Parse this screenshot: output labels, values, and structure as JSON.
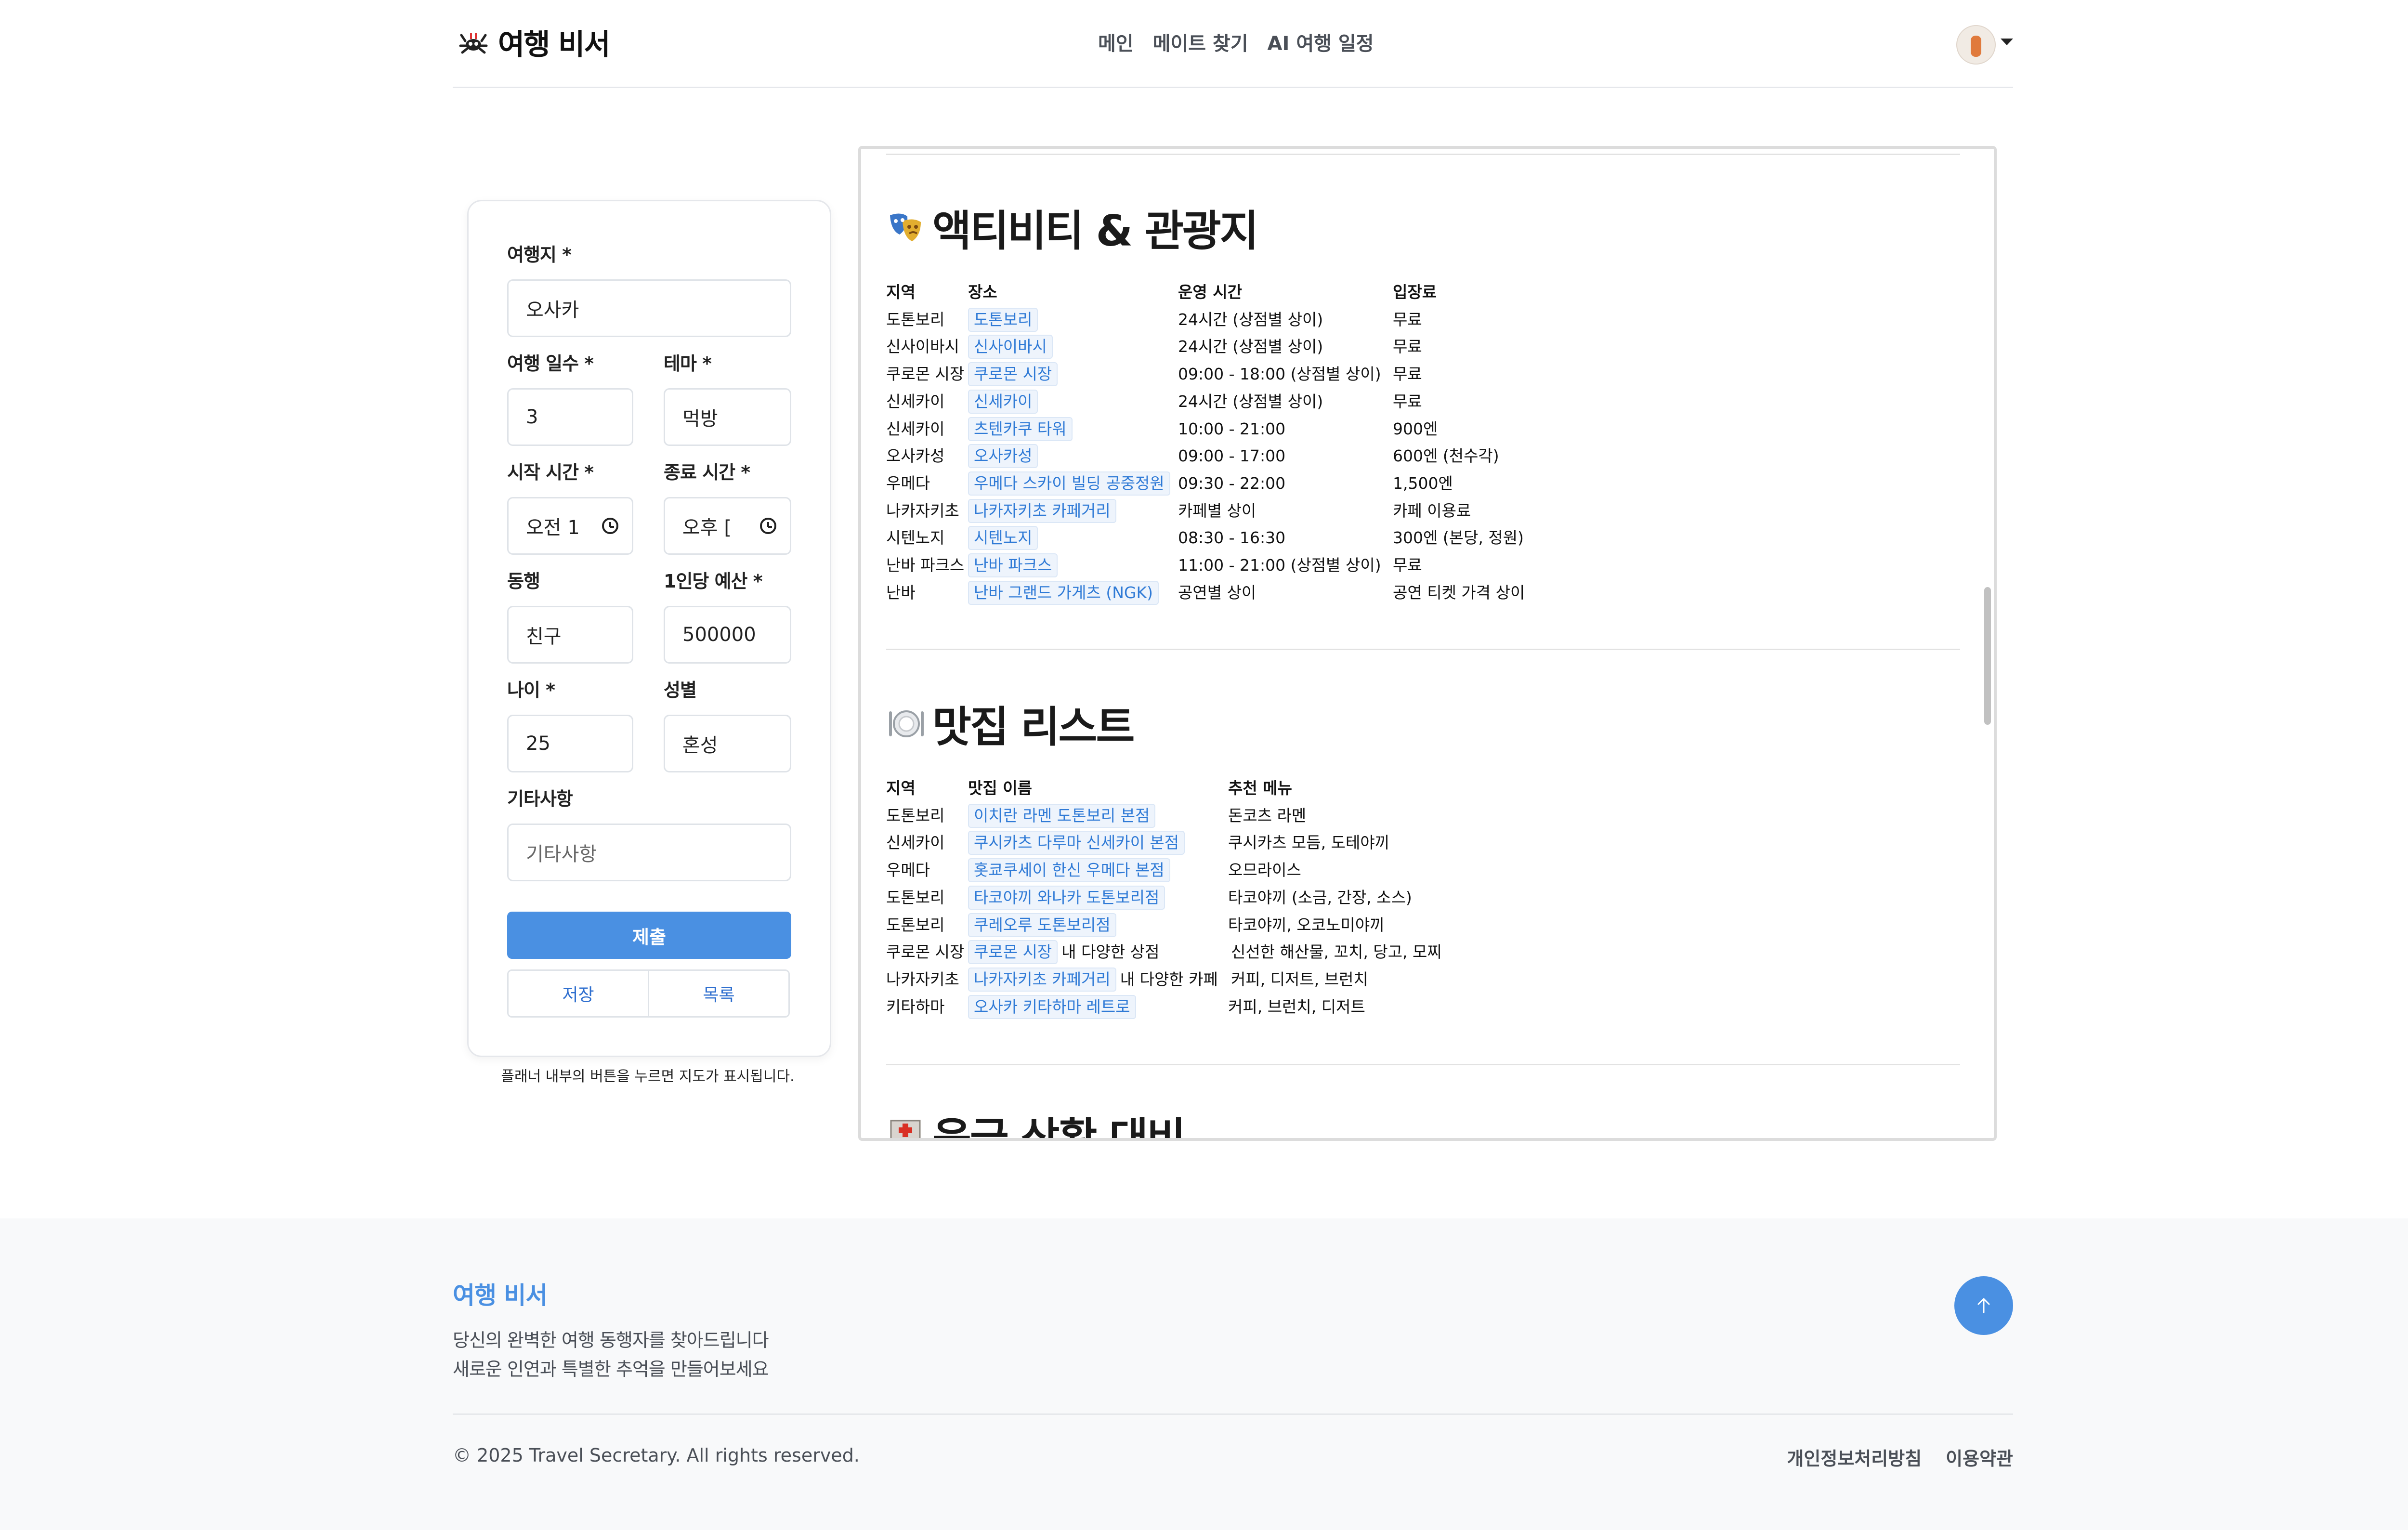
{
  "header": {
    "brand": "여행 비서",
    "nav": [
      "메인",
      "메이트 찾기",
      "AI 여행 일정"
    ]
  },
  "form": {
    "destination": {
      "label": "여행지 *",
      "value": "오사카"
    },
    "days": {
      "label": "여행 일수 *",
      "value": "3"
    },
    "theme": {
      "label": "테마 *",
      "value": "먹방"
    },
    "start_time": {
      "label": "시작 시간 *",
      "value": "오전 1"
    },
    "end_time": {
      "label": "종료 시간 *",
      "value": "오후 ["
    },
    "companion": {
      "label": "동행",
      "value": "친구"
    },
    "budget": {
      "label": "1인당 예산 *",
      "value": "500000"
    },
    "age": {
      "label": "나이 *",
      "value": "25"
    },
    "gender": {
      "label": "성별",
      "value": "혼성"
    },
    "etc": {
      "label": "기타사항",
      "placeholder": "기타사항"
    },
    "submit_label": "제출",
    "save_label": "저장",
    "list_label": "목록",
    "hint": "플래너 내부의 버튼을 누르면 지도가 표시됩니다."
  },
  "activities": {
    "title": "액티비티 & 관광지",
    "headers": [
      "지역",
      "장소",
      "운영 시간",
      "입장료"
    ],
    "rows": [
      [
        "도톤보리",
        "도톤보리",
        "24시간 (상점별 상이)",
        "무료"
      ],
      [
        "신사이바시",
        "신사이바시",
        "24시간 (상점별 상이)",
        "무료"
      ],
      [
        "쿠로몬 시장",
        "쿠로몬 시장",
        "09:00 - 18:00 (상점별 상이)",
        "무료"
      ],
      [
        "신세카이",
        "신세카이",
        "24시간 (상점별 상이)",
        "무료"
      ],
      [
        "신세카이",
        "츠텐카쿠 타워",
        "10:00 - 21:00",
        "900엔"
      ],
      [
        "오사카성",
        "오사카성",
        "09:00 - 17:00",
        "600엔 (천수각)"
      ],
      [
        "우메다",
        "우메다 스카이 빌딩 공중정원",
        "09:30 - 22:00",
        "1,500엔"
      ],
      [
        "나카자키초",
        "나카자키초 카페거리",
        "카페별 상이",
        "카페 이용료"
      ],
      [
        "시텐노지",
        "시텐노지",
        "08:30 - 16:30",
        "300엔 (본당, 정원)"
      ],
      [
        "난바 파크스",
        "난바 파크스",
        "11:00 - 21:00 (상점별 상이)",
        "무료"
      ],
      [
        "난바",
        "난바 그랜드 가게츠 (NGK)",
        "공연별 상이",
        "공연 티켓 가격 상이"
      ]
    ]
  },
  "restaurants": {
    "title": "맛집 리스트",
    "headers": [
      "지역",
      "맛집 이름",
      "추천 메뉴"
    ],
    "rows": [
      [
        "도톤보리",
        "이치란 라멘 도톤보리 본점",
        "",
        "돈코츠 라멘"
      ],
      [
        "신세카이",
        "쿠시카츠 다루마 신세카이 본점",
        "",
        "쿠시카츠 모듬, 도테야끼"
      ],
      [
        "우메다",
        "홋쿄쿠세이 한신 우메다 본점",
        "",
        "오므라이스"
      ],
      [
        "도톤보리",
        "타코야끼 와나카 도톤보리점",
        "",
        "타코야끼 (소금, 간장, 소스)"
      ],
      [
        "도톤보리",
        "쿠레오루 도톤보리점",
        "",
        "타코야끼, 오코노미야끼"
      ],
      [
        "쿠로몬 시장",
        "쿠로몬 시장",
        "내 다양한 상점",
        "신선한 해산물, 꼬치, 당고, 모찌"
      ],
      [
        "나카자키초",
        "나카자키초 카페거리",
        "내 다양한 카페",
        "커피, 디저트, 브런치"
      ],
      [
        "키타하마",
        "오사카 키타하마 레트로",
        "",
        "커피, 브런치, 디저트"
      ]
    ]
  },
  "emergency": {
    "title": "응급 상황 대비"
  },
  "footer": {
    "title": "여행 비서",
    "line1": "당신의 완벽한 여행 동행자를 찾아드립니다",
    "line2": "새로운 인연과 특별한 추억을 만들어보세요",
    "copyright": "© 2025 Travel Secretary. All rights reserved.",
    "links": [
      "개인정보처리방침",
      "이용약관"
    ]
  },
  "colors": {
    "accent": "#4a90e2",
    "link_bg": "#eef4fc",
    "link_text": "#2f7ad6"
  },
  "icons": [
    "brand-crab-icon",
    "avatar",
    "clock-icon",
    "mask-icon",
    "plate-icon",
    "hospital-icon",
    "arrow-up-icon"
  ]
}
